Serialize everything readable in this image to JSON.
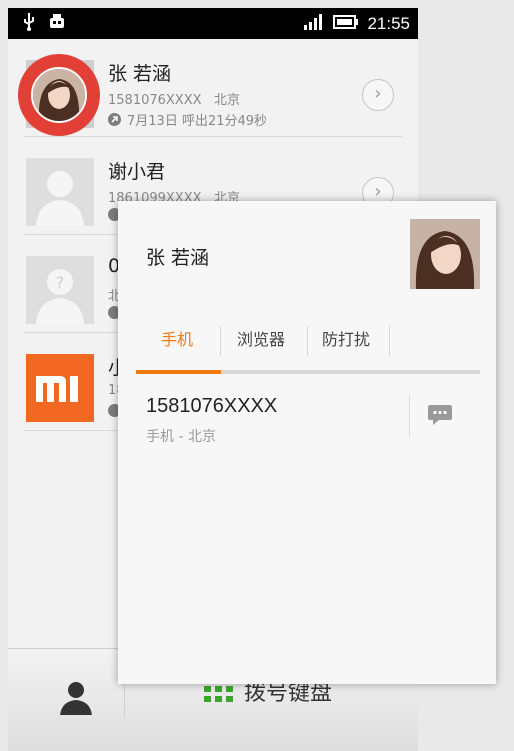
{
  "statusbar": {
    "time": "21:55",
    "icons": [
      "usb-icon",
      "android-debug-icon",
      "signal-icon",
      "battery-icon"
    ]
  },
  "contacts": [
    {
      "name": "张 若涵",
      "number": "1581076XXXX",
      "location": "北京",
      "last_call": "7月13日 呼出21分49秒",
      "call_type": "outgoing"
    },
    {
      "name": "谢小君",
      "number": "1861099XXXX",
      "location": "北京"
    },
    {
      "name": "0",
      "number": "北"
    },
    {
      "name": "小",
      "number": "18"
    }
  ],
  "popup": {
    "name": "张 若涵",
    "tabs": [
      {
        "label": "手机",
        "active": true
      },
      {
        "label": "浏览器",
        "active": false
      },
      {
        "label": "防打扰",
        "active": false
      }
    ],
    "phone_number": "1581076XXXX",
    "phone_type": "手机 - 北京"
  },
  "bottombar": {
    "dialpad_label": "拨号键盘"
  },
  "colors": {
    "accent": "#f07b12",
    "highlight": "#e23f36",
    "mi_orange": "#f26722",
    "dialpad_green": "#3aa52a"
  }
}
